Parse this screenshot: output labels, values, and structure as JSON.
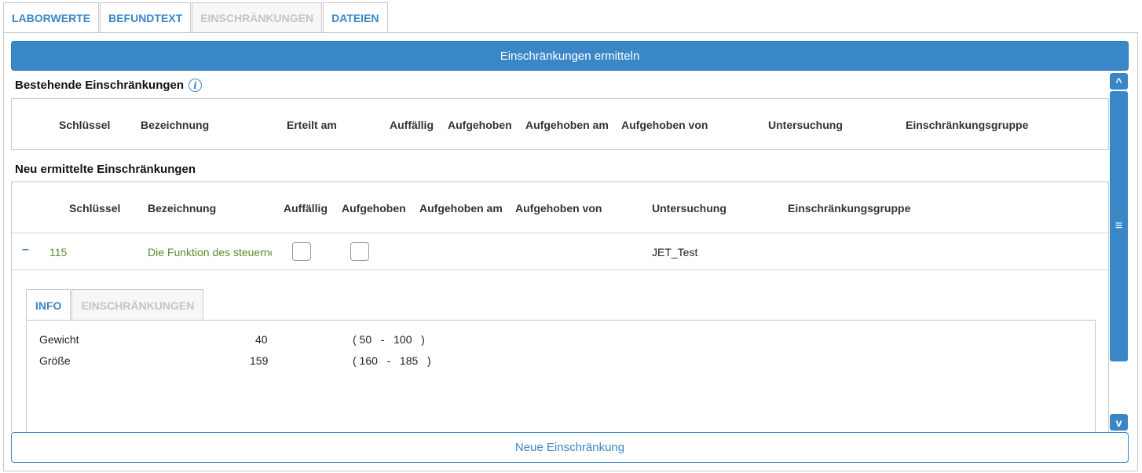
{
  "top_tabs": [
    {
      "label": "LABORWERTE",
      "active": true
    },
    {
      "label": "BEFUNDTEXT",
      "active": true
    },
    {
      "label": "EINSCHRÄNKUNGEN",
      "active": false
    },
    {
      "label": "DATEIEN",
      "active": true
    }
  ],
  "actions": {
    "determine_label": "Einschränkungen ermitteln",
    "new_label": "Neue Einschränkung"
  },
  "existing": {
    "title": "Bestehende Einschränkungen",
    "info_glyph": "i",
    "columns": [
      "Schlüssel",
      "Bezeichnung",
      "Erteilt am",
      "Auffällig",
      "Aufgehoben",
      "Aufgehoben am",
      "Aufgehoben von",
      "Untersuchung",
      "Einschränkungsgruppe"
    ]
  },
  "new": {
    "title": "Neu ermittelte Einschränkungen",
    "columns": [
      "Schlüssel",
      "Bezeichnung",
      "Auffällig",
      "Aufgehoben",
      "Aufgehoben am",
      "Aufgehoben von",
      "Untersuchung",
      "Einschränkungsgruppe"
    ],
    "rows": [
      {
        "collapse_glyph": "–",
        "key": "115",
        "designation": "Die Funktion des steuernc",
        "conspicuous": false,
        "revoked": false,
        "revoked_at": "",
        "revoked_by": "",
        "examination": "JET_Test",
        "group": ""
      }
    ]
  },
  "detail": {
    "tabs": [
      {
        "label": "INFO",
        "active": true
      },
      {
        "label": "EINSCHRÄNKUNGEN",
        "active": false
      }
    ],
    "lab_values": [
      {
        "name": "Gewicht",
        "value": "40",
        "range": "( 50   -   100   )"
      },
      {
        "name": "Größe",
        "value": "159",
        "range": "( 160   -   185   )"
      }
    ]
  },
  "scrollbar": {
    "up_glyph": "^",
    "thumb_glyph": "≡",
    "down_glyph": "v"
  },
  "colors": {
    "accent": "#3a87c7",
    "green_text": "#5f8b2e",
    "disabled_tab": "#c4c4c4"
  }
}
